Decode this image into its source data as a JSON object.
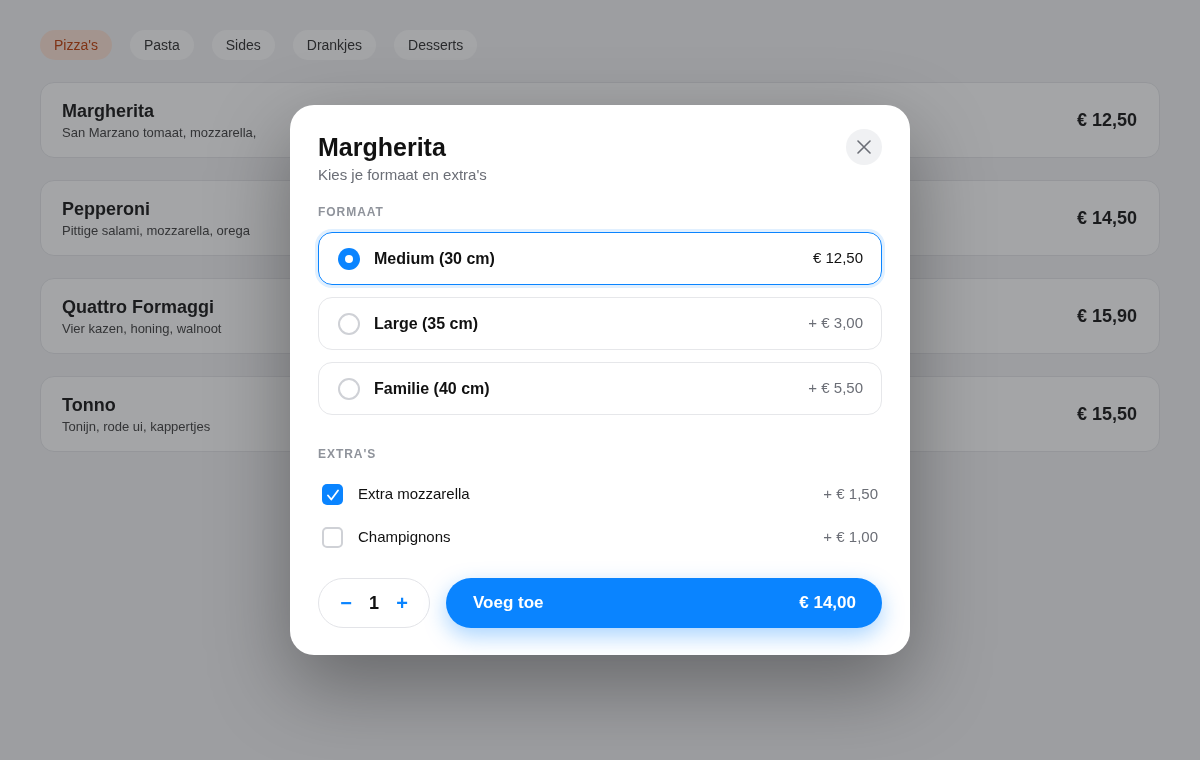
{
  "menu": {
    "tabs": [
      {
        "label": "Pizza's",
        "selected": true
      },
      {
        "label": "Pasta",
        "selected": false
      },
      {
        "label": "Sides",
        "selected": false
      },
      {
        "label": "Drankjes",
        "selected": false
      },
      {
        "label": "Desserts",
        "selected": false
      }
    ],
    "items": [
      {
        "name": "Margherita",
        "description": "San Marzano tomaat, mozzarella,",
        "price": "€ 12,50"
      },
      {
        "name": "Pepperoni",
        "description": "Pittige salami, mozzarella, orega",
        "price": "€ 14,50"
      },
      {
        "name": "Quattro Formaggi",
        "description": "Vier kazen, honing, walnoot",
        "price": "€ 15,90"
      },
      {
        "name": "Tonno",
        "description": "Tonijn, rode ui, kappertjes",
        "price": "€ 15,50"
      }
    ]
  },
  "dialog": {
    "title": "Margherita",
    "subtitle": "Kies je formaat en extra's",
    "size_section": {
      "label": "FORMAAT",
      "options": [
        {
          "label": "Medium (30 cm)",
          "price": "€ 12,50",
          "selected": true
        },
        {
          "label": "Large (35 cm)",
          "price": "+ € 3,00",
          "selected": false
        },
        {
          "label": "Familie (40 cm)",
          "price": "+ € 5,50",
          "selected": false
        }
      ]
    },
    "extras_section": {
      "label": "EXTRA'S",
      "options": [
        {
          "label": "Extra mozzarella",
          "price": "+ € 1,50",
          "checked": true
        },
        {
          "label": "Champignons",
          "price": "+ € 1,00",
          "checked": false
        }
      ]
    },
    "quantity": {
      "decrease": "−",
      "value": "1",
      "increase": "+"
    },
    "add_button": {
      "label": "Voeg toe",
      "total": "€ 14,00"
    }
  }
}
